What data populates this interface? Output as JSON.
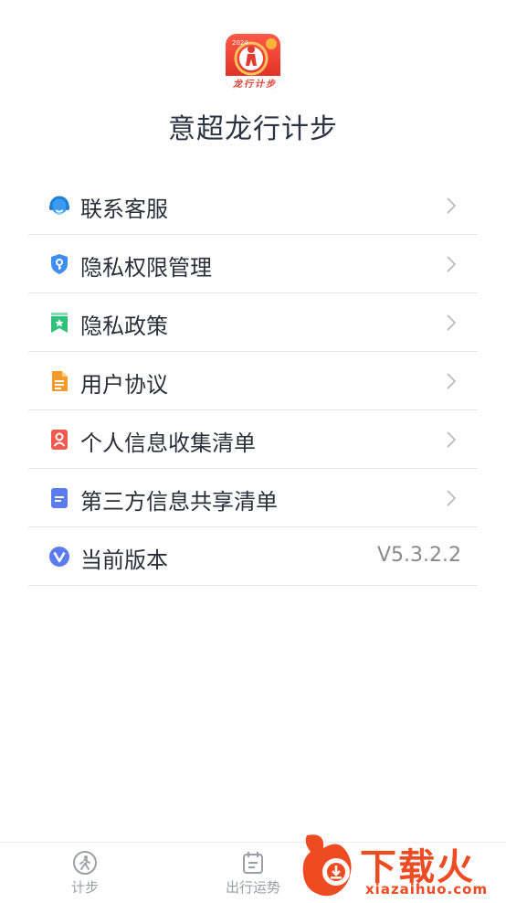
{
  "app": {
    "name": "意超龙行计步",
    "logo_text": "龙行计步",
    "logo_year": "2024"
  },
  "menu": [
    {
      "label": "联系客服",
      "icon": "customer-service-headset-icon",
      "color": "#3a9bf0"
    },
    {
      "label": "隐私权限管理",
      "icon": "shield-key-icon",
      "color": "#3f8ef3"
    },
    {
      "label": "隐私政策",
      "icon": "bookmark-star-icon",
      "color": "#2fc07a"
    },
    {
      "label": "用户协议",
      "icon": "document-icon",
      "color": "#f59b2b"
    },
    {
      "label": "个人信息收集清单",
      "icon": "person-card-icon",
      "color": "#ef5a4f"
    },
    {
      "label": "第三方信息共享清单",
      "icon": "list-doc-icon",
      "color": "#5b7cf0"
    },
    {
      "label": "当前版本",
      "icon": "version-v-icon",
      "color": "#5b7cf0",
      "value": "V5.3.2.2"
    }
  ],
  "tabbar": {
    "tabs": [
      {
        "label": "计步",
        "icon": "walking-person-icon"
      },
      {
        "label": "出行运势",
        "icon": "calendar-icon"
      }
    ]
  },
  "watermark": {
    "brand": "下载火",
    "domain": "xiazaihuo.com"
  },
  "colors": {
    "divider": "#e6e6e6",
    "chevron": "#b8b8b8",
    "watermark": "#ef4b23",
    "logo_red": "#e23a2e"
  }
}
